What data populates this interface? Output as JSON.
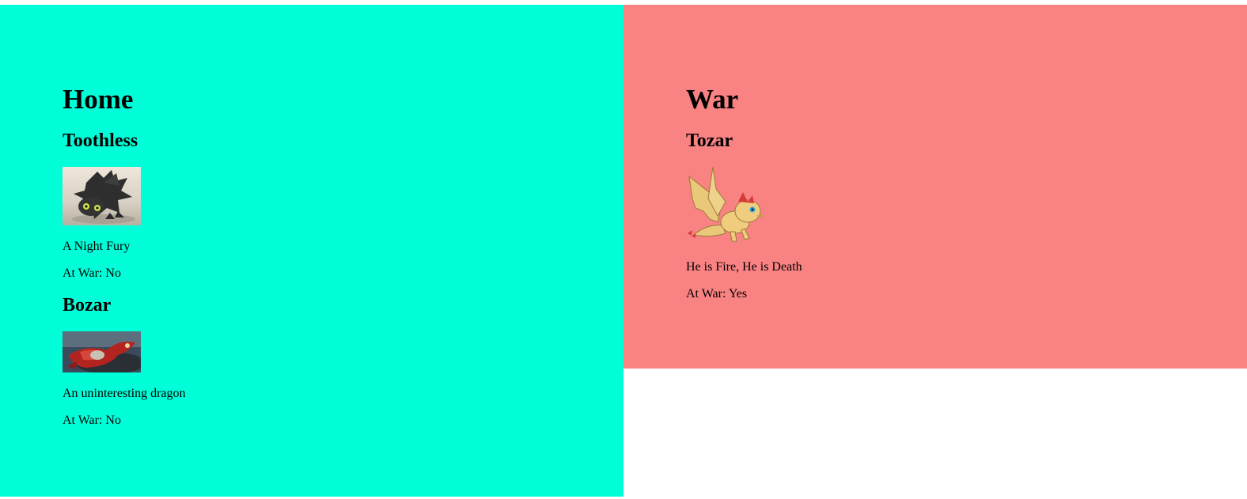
{
  "colors": {
    "home_bg": "#00ffd9",
    "war_bg": "#f98282",
    "page_bg": "#ffffff"
  },
  "home": {
    "title": "Home",
    "dragons": [
      {
        "name": "Toothless",
        "image": "black-dragon-image",
        "description": "A Night Fury",
        "at_war": "At War: No"
      },
      {
        "name": "Bozar",
        "image": "red-dragon-image",
        "description": "An uninteresting dragon",
        "at_war": "At War: No"
      }
    ]
  },
  "war": {
    "title": "War",
    "dragons": [
      {
        "name": "Tozar",
        "image": "yellow-dragon-image",
        "description": "He is Fire, He is Death",
        "at_war": "At War: Yes"
      }
    ]
  }
}
